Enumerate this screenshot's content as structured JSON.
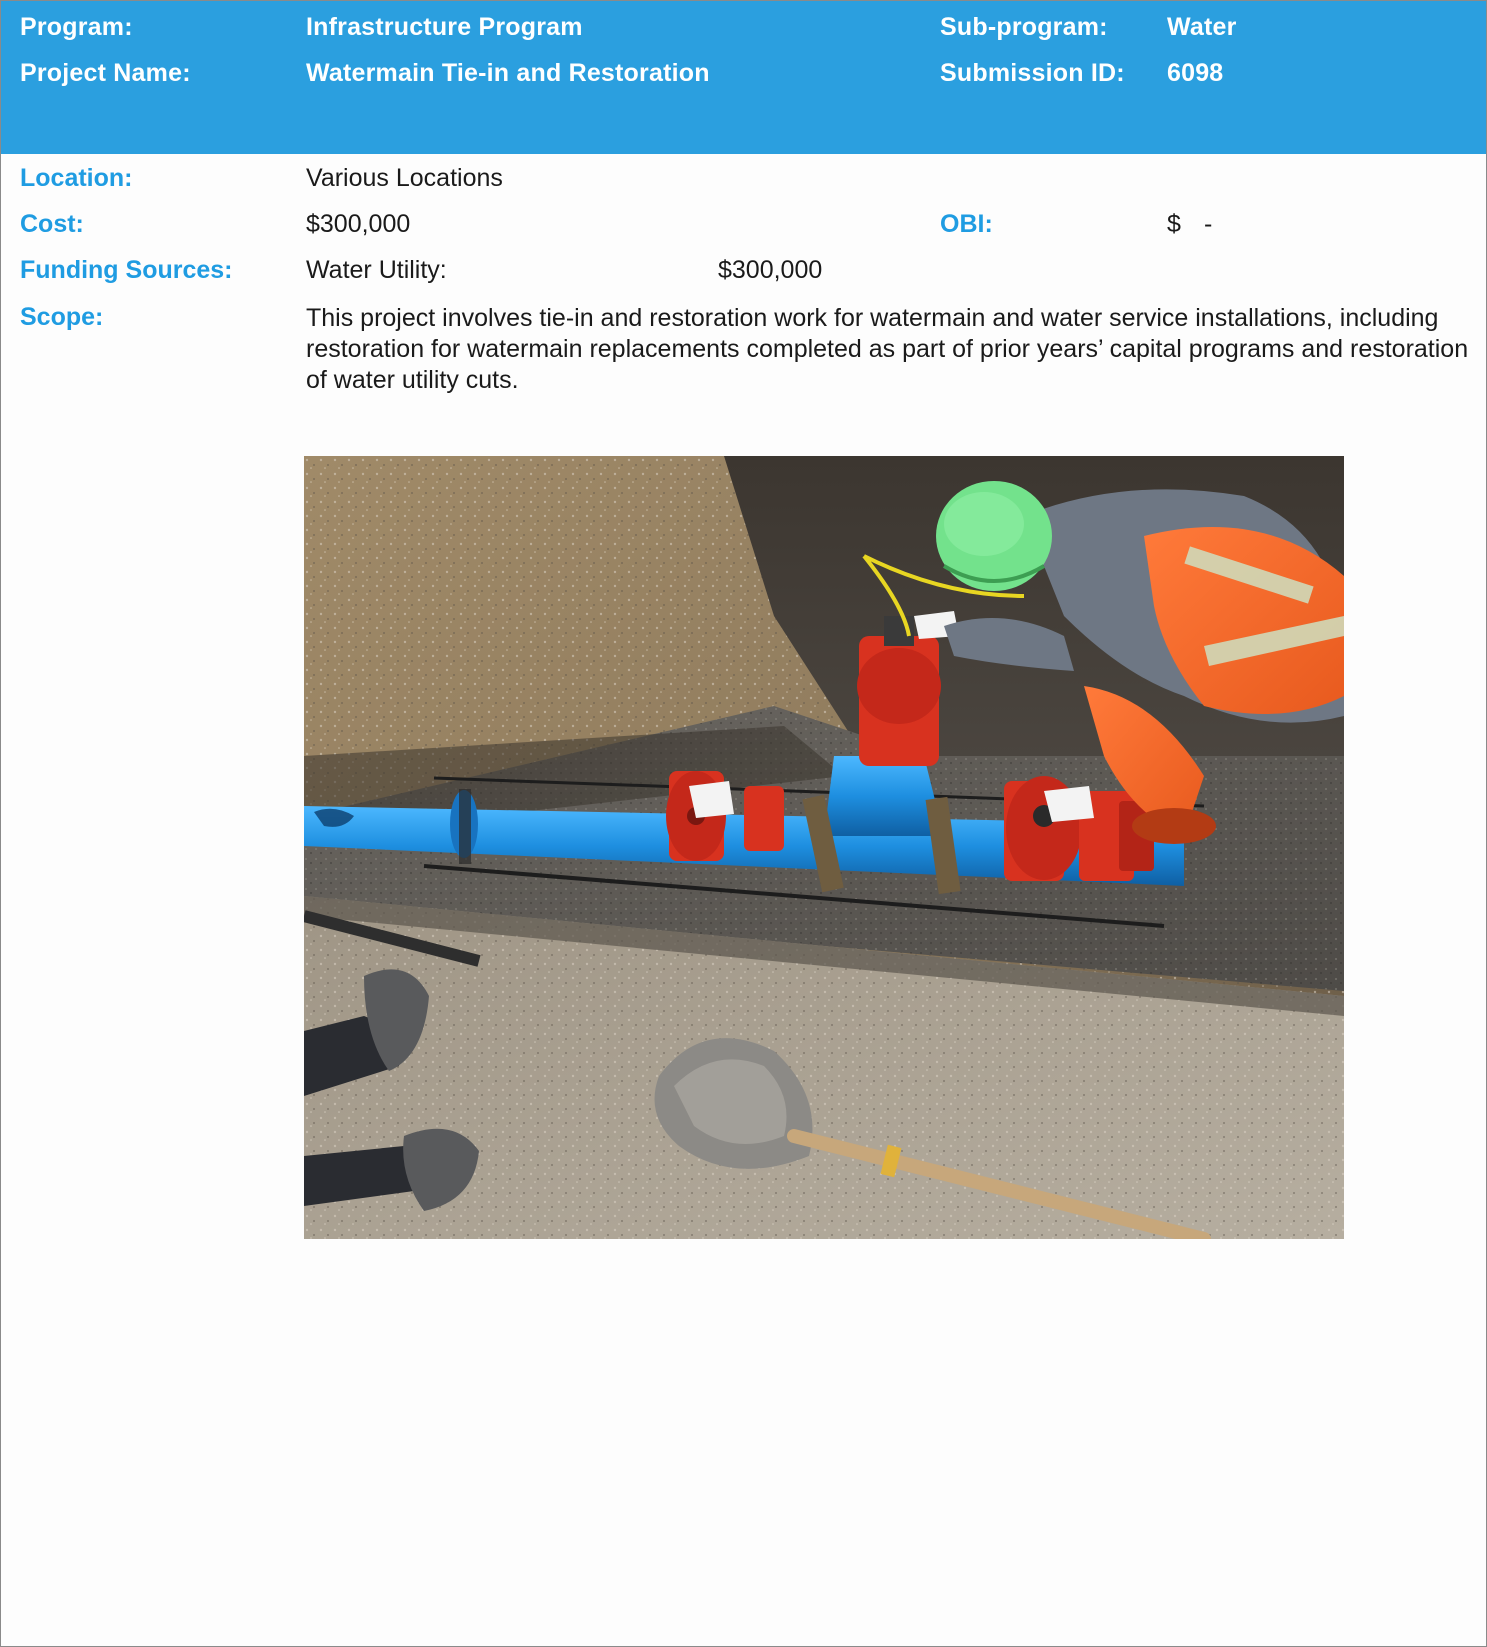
{
  "header": {
    "program_label": "Program:",
    "program_value": "Infrastructure Program",
    "subprogram_label": "Sub-program:",
    "subprogram_value": "Water",
    "project_name_label": "Project Name:",
    "project_name_value": "Watermain Tie-in and Restoration",
    "submission_id_label": "Submission ID:",
    "submission_id_value": "6098"
  },
  "details": {
    "location_label": "Location:",
    "location_value": "Various Locations",
    "cost_label": "Cost:",
    "cost_value": "$300,000",
    "obi_label": "OBI:",
    "obi_currency": "$",
    "obi_value": "-",
    "funding_label": "Funding Sources:",
    "funding_source_name": "Water Utility:",
    "funding_source_amount": "$300,000",
    "scope_label": "Scope:",
    "scope_text": "This project involves tie-in and restoration work for watermain and water service installations, including restoration for watermain replacements completed as part of prior years’ capital programs and restoration of water utility cuts."
  },
  "colors": {
    "header_background": "#2b9fdf",
    "label_blue": "#1f9ce2"
  }
}
